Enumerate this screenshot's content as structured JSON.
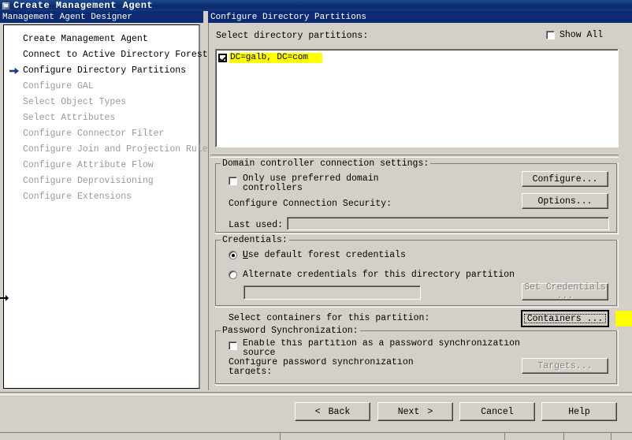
{
  "window": {
    "title": "Create Management Agent",
    "icon": "wizard-app-icon"
  },
  "panes": {
    "left_header": "Management Agent Designer",
    "right_header": "Configure Directory Partitions"
  },
  "nav": {
    "items": [
      {
        "label": "Create Management Agent",
        "state": "done"
      },
      {
        "label": "Connect to Active Directory Forest",
        "state": "done"
      },
      {
        "label": "Configure Directory Partitions",
        "state": "current"
      },
      {
        "label": "Configure GAL",
        "state": "future"
      },
      {
        "label": "Select Object Types",
        "state": "future"
      },
      {
        "label": "Select Attributes",
        "state": "future"
      },
      {
        "label": "Configure Connector Filter",
        "state": "future"
      },
      {
        "label": "Configure Join and Projection Rules",
        "state": "future"
      },
      {
        "label": "Configure Attribute Flow",
        "state": "future"
      },
      {
        "label": "Configure Deprovisioning",
        "state": "future"
      },
      {
        "label": "Configure Extensions",
        "state": "future"
      }
    ]
  },
  "partitions": {
    "select_label": "Select directory partitions:",
    "show_all_label": "Show All",
    "show_all_checked": false,
    "items": [
      {
        "label": "DC=galb, DC=com",
        "checked": true,
        "highlighted": true
      }
    ]
  },
  "dc_settings": {
    "group_title": "Domain controller connection settings:",
    "only_preferred_label_line1": "Only use preferred domain",
    "only_preferred_label_line2": "controllers",
    "only_preferred_checked": false,
    "connection_security_label": "Configure Connection Security:",
    "last_used_label": "Last used:",
    "last_used_value": "",
    "configure_button": "Configure...",
    "options_button": "Options..."
  },
  "credentials": {
    "group_title": "Credentials:",
    "use_default_label": "Use default forest credentials",
    "alternate_label": "Alternate credentials for this directory partition",
    "selected": "use_default",
    "alternate_value": "",
    "set_credentials_button_line1": "Set Credentials",
    "set_credentials_button_line2": "...",
    "set_credentials_enabled": false
  },
  "containers": {
    "label": "Select containers for this partition:",
    "button": "Containers ...",
    "button_focused": true,
    "highlight_color": "#ffff00"
  },
  "password_sync": {
    "group_title": "Password Synchronization:",
    "enable_label_line1": "Enable this partition as a password synchronization",
    "enable_label_line2": "source",
    "enable_checked": false,
    "configure_label_line1": "Configure password synchronization",
    "configure_label_line2": "targets:",
    "targets_button": "Targets...",
    "targets_enabled": false
  },
  "wizard_buttons": {
    "back": "Back",
    "back_glyph": "<",
    "next": "Next",
    "next_glyph": ">",
    "cancel": "Cancel",
    "help": "Help"
  },
  "colors": {
    "titlebar": "#0a2a6b",
    "header": "#0c2b72",
    "face": "#d4d0c8",
    "highlight": "#ffff00",
    "disabled_text": "#808080"
  }
}
